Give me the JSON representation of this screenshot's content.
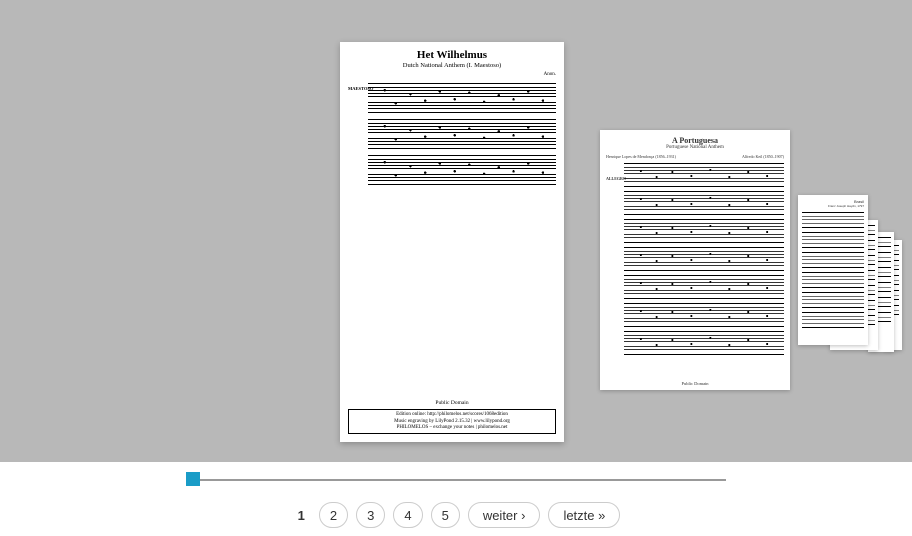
{
  "viewer": {
    "main_sheet": {
      "title": "Het Wilhelmus",
      "subtitle": "Dutch National Anthem (I. Maestoso)",
      "author": "Anon.",
      "tempo": "MAESTOSO",
      "footer_public_domain": "Public Domain",
      "footer_line1": "Edition online: http://philomelos.net/scores/1068edition",
      "footer_line2": "Music engraving by LilyPond 2.15.32 | www.lilypond.org",
      "footer_line3": "PHILOMELOS – exchange your notes | philomelos.net"
    },
    "next_sheet": {
      "title": "A Portuguesa",
      "subtitle": "Portuguese National Anthem",
      "composer_left": "Henrique Lopes de Mendonça (1856–1931)",
      "composer_right": "Alfredo Keil (1850–1907)",
      "tempo": "ALLEGRO",
      "footer": "Public Domain"
    },
    "peek_sheet": {
      "composer": "Franz Joseph Haydn, 1797",
      "title_hint": "Brasil"
    }
  },
  "slider": {
    "position_percent": 0
  },
  "pagination": {
    "current": "1",
    "pages": [
      "2",
      "3",
      "4",
      "5"
    ],
    "next_label": "weiter ›",
    "last_label": "letzte »"
  }
}
